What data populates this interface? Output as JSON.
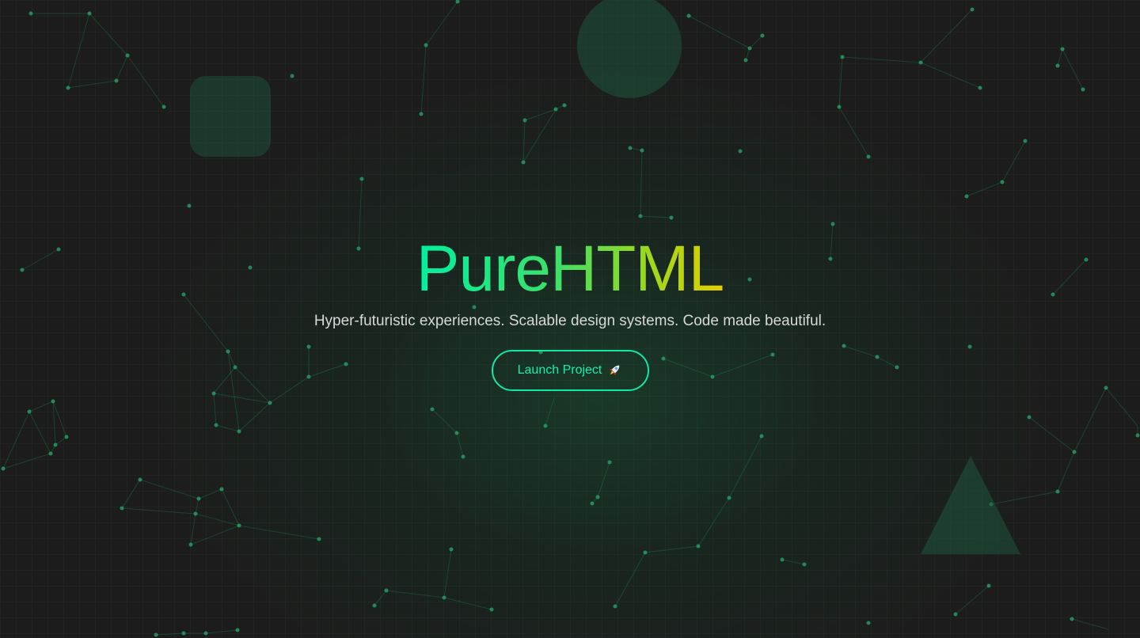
{
  "hero": {
    "title": "PureHTML",
    "subtitle": "Hyper-futuristic experiences. Scalable design systems. Code made beautiful.",
    "cta_label": "Launch Project",
    "cta_icon": "rocket-icon"
  },
  "colors": {
    "background": "#1c1c1c",
    "accent": "#11e7a6",
    "title_gradient": [
      "#00f0a0",
      "#3ddf6a",
      "#9ad81c",
      "#e4cd00"
    ],
    "subtitle_text": "#d8d8d8"
  },
  "decor": {
    "shapes": [
      "rounded-square",
      "circle",
      "triangle"
    ],
    "background_pattern": "grid with connected particle network"
  }
}
